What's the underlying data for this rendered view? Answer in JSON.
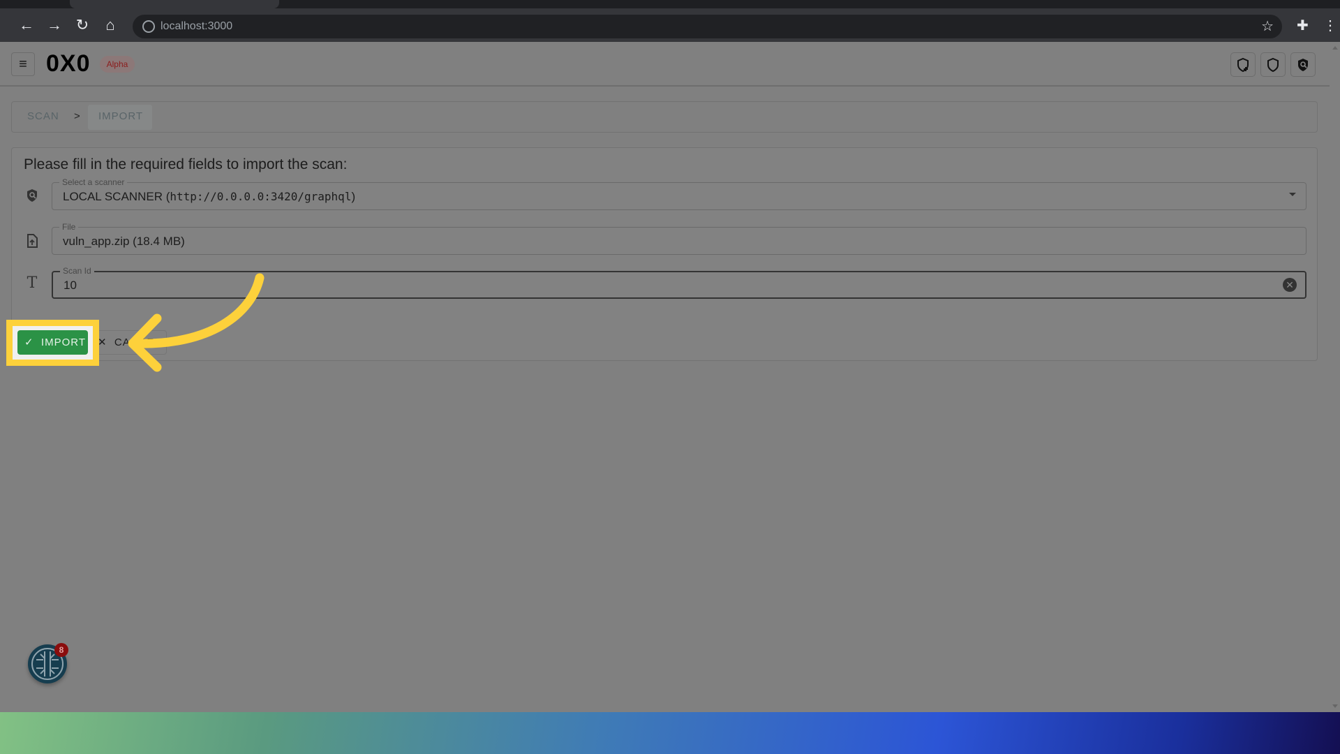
{
  "browser": {
    "url": "localhost:3000"
  },
  "header": {
    "logo": "0X0",
    "badge": "Alpha",
    "icons": [
      "shield-plus-icon",
      "shield-icon",
      "shield-search-icon"
    ]
  },
  "breadcrumb": {
    "items": [
      "SCAN",
      "IMPORT"
    ],
    "separator": ">"
  },
  "form": {
    "heading": "Please fill in the required fields to import the scan:",
    "scanner": {
      "label": "Select a scanner",
      "value_prefix": "LOCAL SCANNER (",
      "value_url": "http://0.0.0.0:3420/graphql",
      "value_suffix": ")"
    },
    "file": {
      "label": "File",
      "value": "vuln_app.zip (18.4 MB)"
    },
    "scan_id": {
      "label": "Scan Id",
      "value": "10"
    },
    "import_label": "IMPORT",
    "cancel_label": "CANCEL"
  },
  "notifications": {
    "count": "8"
  },
  "colors": {
    "accent_green": "#2b9246",
    "highlight": "#fdd13b",
    "badge_red": "#8a0d0d"
  }
}
